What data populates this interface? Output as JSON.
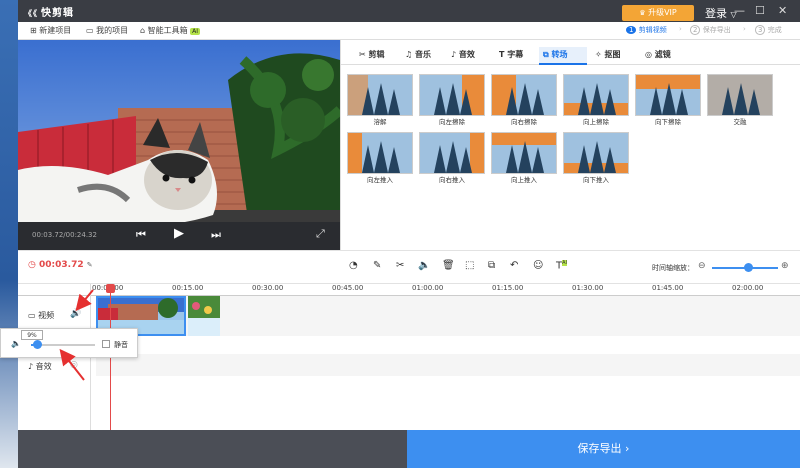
{
  "titlebar": {
    "app_name": "快剪辑",
    "vip_label": "升级VIP",
    "login_label": "登录"
  },
  "toolbar": {
    "new_project": "新建项目",
    "my_projects": "我的项目",
    "smart_tools": "智能工具箱",
    "ai_badge": "AI",
    "steps": [
      {
        "num": "1",
        "label": "剪辑视频"
      },
      {
        "num": "2",
        "label": "保存导出"
      },
      {
        "num": "3",
        "label": "完成"
      }
    ]
  },
  "player": {
    "time": "00:03.72/00:24.32"
  },
  "tabs": [
    {
      "label": "剪辑"
    },
    {
      "label": "音乐"
    },
    {
      "label": "音效"
    },
    {
      "label": "字幕"
    },
    {
      "label": "转场"
    },
    {
      "label": "抠图"
    },
    {
      "label": "滤镜"
    }
  ],
  "active_tab": "转场",
  "transitions": [
    {
      "label": "溶解"
    },
    {
      "label": "向左擦除"
    },
    {
      "label": "向右擦除"
    },
    {
      "label": "向上擦除"
    },
    {
      "label": "向下擦除"
    },
    {
      "label": "交融"
    },
    {
      "label": "向左推入"
    },
    {
      "label": "向右推入"
    },
    {
      "label": "向上推入"
    },
    {
      "label": "向下推入"
    }
  ],
  "timeline": {
    "current_time": "00:03.72",
    "zoom_label": "时间轴缩放：",
    "ruler": [
      "00:00.00",
      "00:15.00",
      "00:30.00",
      "00:45.00",
      "01:00.00",
      "01:15.00",
      "01:30.00",
      "01:45.00",
      "02:00.00"
    ],
    "track_video_label": "视频",
    "track_audio_label": "音效"
  },
  "volume_popup": {
    "percent": "9%",
    "mute_label": "静音",
    "level": 0.09
  },
  "export": {
    "label": "保存导出 ›"
  },
  "colors": {
    "accent": "#3d8ff0",
    "vip": "#f3a536",
    "playhead": "#e34a4a",
    "time_red": "#e34a4a"
  }
}
